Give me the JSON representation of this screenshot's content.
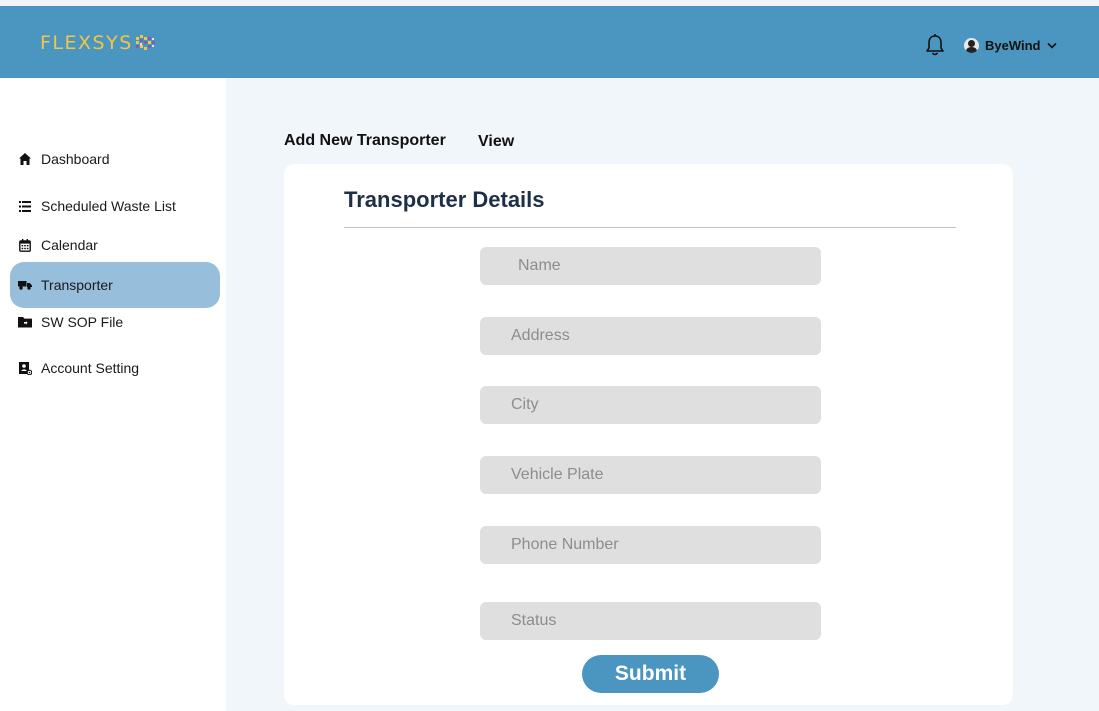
{
  "brand": {
    "logo_text": "FLEXSYS",
    "logo_color": "#f2c544"
  },
  "colors": {
    "header": "#4b96c0",
    "active_nav": "#97bedb",
    "main_bg": "#f1f6fa",
    "field_bg": "#dfdfdf"
  },
  "header": {
    "bell_icon": "bell-icon",
    "user": {
      "name": "ByeWind",
      "avatar_icon": "user-avatar",
      "menu_icon": "chevron-down-icon"
    }
  },
  "sidebar": {
    "items": [
      {
        "label": "Dashboard",
        "icon": "home-icon",
        "active": false
      },
      {
        "label": "Scheduled Waste List",
        "icon": "list-icon",
        "active": false
      },
      {
        "label": "Calendar",
        "icon": "calendar-icon",
        "active": false
      },
      {
        "label": "Transporter",
        "icon": "truck-icon",
        "active": true
      },
      {
        "label": "SW SOP File",
        "icon": "folder-icon",
        "active": false
      },
      {
        "label": "Account Setting",
        "icon": "account-settings-icon",
        "active": false
      }
    ]
  },
  "tabs": [
    {
      "label": "Add New Transporter",
      "active": true
    },
    {
      "label": "View",
      "active": false
    }
  ],
  "form": {
    "title": "Transporter Details",
    "fields": [
      {
        "placeholder": "Name",
        "value": ""
      },
      {
        "placeholder": "Address",
        "value": ""
      },
      {
        "placeholder": "City",
        "value": ""
      },
      {
        "placeholder": "Vehicle Plate",
        "value": ""
      },
      {
        "placeholder": "Phone Number",
        "value": ""
      },
      {
        "placeholder": "Status",
        "value": ""
      }
    ],
    "submit_label": "Submit"
  }
}
